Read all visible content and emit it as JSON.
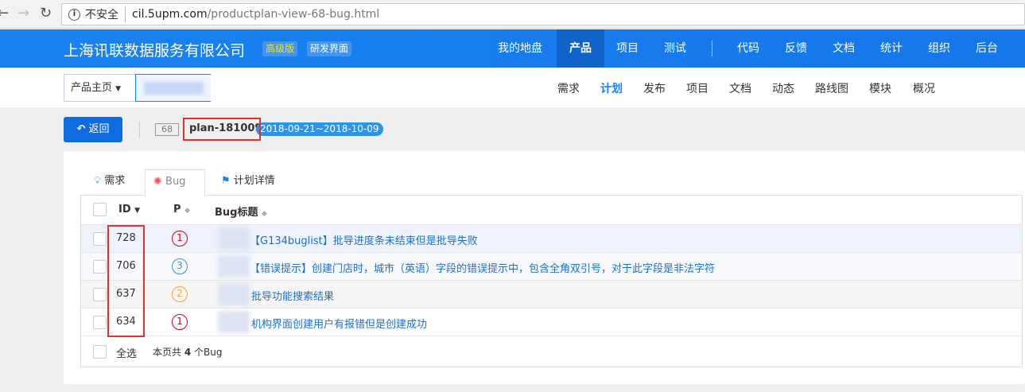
{
  "browser": {
    "security": "不安全",
    "url_host": "cil.5upm.com",
    "url_path": "/productplan-view-68-bug.html"
  },
  "header": {
    "company": "上海讯联数据服务有限公司",
    "edition_tag": "高级版",
    "mode_tag": "研发界面",
    "nav": [
      "我的地盘",
      "产品",
      "项目",
      "测试",
      "代码",
      "反馈",
      "文档",
      "统计",
      "组织",
      "后台"
    ],
    "active_nav": "产品"
  },
  "subnav": {
    "product_home": "产品主页",
    "items": [
      "需求",
      "计划",
      "发布",
      "项目",
      "文档",
      "动态",
      "路线图",
      "模块",
      "概况"
    ],
    "active": "计划"
  },
  "plan": {
    "back_label": "返回",
    "id": "68",
    "title": "plan-181009",
    "dates": "2018-09-21~2018-10-09"
  },
  "tabs": [
    "需求",
    "Bug",
    "计划详情"
  ],
  "table": {
    "headers": [
      "ID",
      "P",
      "Bug标题"
    ],
    "rows": [
      {
        "id": "728",
        "priority": "1",
        "title": "【G134buglist】批导进度条未结束但是批导失败"
      },
      {
        "id": "706",
        "priority": "3",
        "title": "【错误提示】创建门店时，城市（英语）字段的错误提示中，包含全角双引号，对于此字段是非法字符"
      },
      {
        "id": "637",
        "priority": "2",
        "title": "批导功能搜索结果"
      },
      {
        "id": "634",
        "priority": "1",
        "title": "机构界面创建用户有报错但是创建成功"
      }
    ],
    "select_all": "全选",
    "summary_prefix": "本页共",
    "count": "4",
    "summary_suffix": "个Bug"
  },
  "colors": {
    "header": "#1a82f0",
    "p1": "#d0021b",
    "p2": "#f5a623",
    "p3": "#2d94ec",
    "annotation": "#e43030"
  }
}
